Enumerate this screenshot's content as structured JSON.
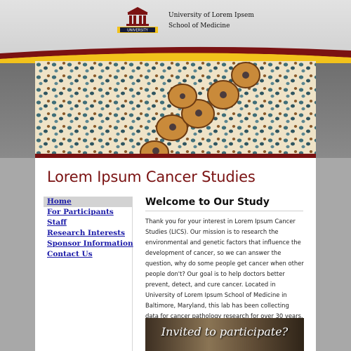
{
  "header": {
    "university_line1": "University of Lorem Ipsem",
    "university_line2": "School of Medicine",
    "logo_label": "UNIVERSITY"
  },
  "colors": {
    "maroon": "#7a1212",
    "gold": "#f2c21b",
    "link": "#1a1aa8"
  },
  "site": {
    "title": "Lorem Ipsum Cancer Studies"
  },
  "nav": {
    "items": [
      {
        "label": "Home",
        "active": true
      },
      {
        "label": "For Participants"
      },
      {
        "label": "Staff"
      },
      {
        "label": "Research Interests"
      },
      {
        "label": "Sponsor Information"
      },
      {
        "label": "Contact Us"
      }
    ]
  },
  "main": {
    "heading": "Welcome to Our Study",
    "body": "Thank you for your interest in Lorem Ipsum Cancer Studies (LICS). Our mission is to research the environmental and genetic factors that influence the development of cancer, so we can answer the question, why do some people get cancer when other people don't? Our goal is to help doctors better prevent, detect, and cure cancer. Located in University of Lorem Ipsum School of Medicine in Baltimore, Maryland, this lab has been collecting data for cancer pathology research for over 30 years.",
    "invite_text": "Invited to participate?"
  }
}
